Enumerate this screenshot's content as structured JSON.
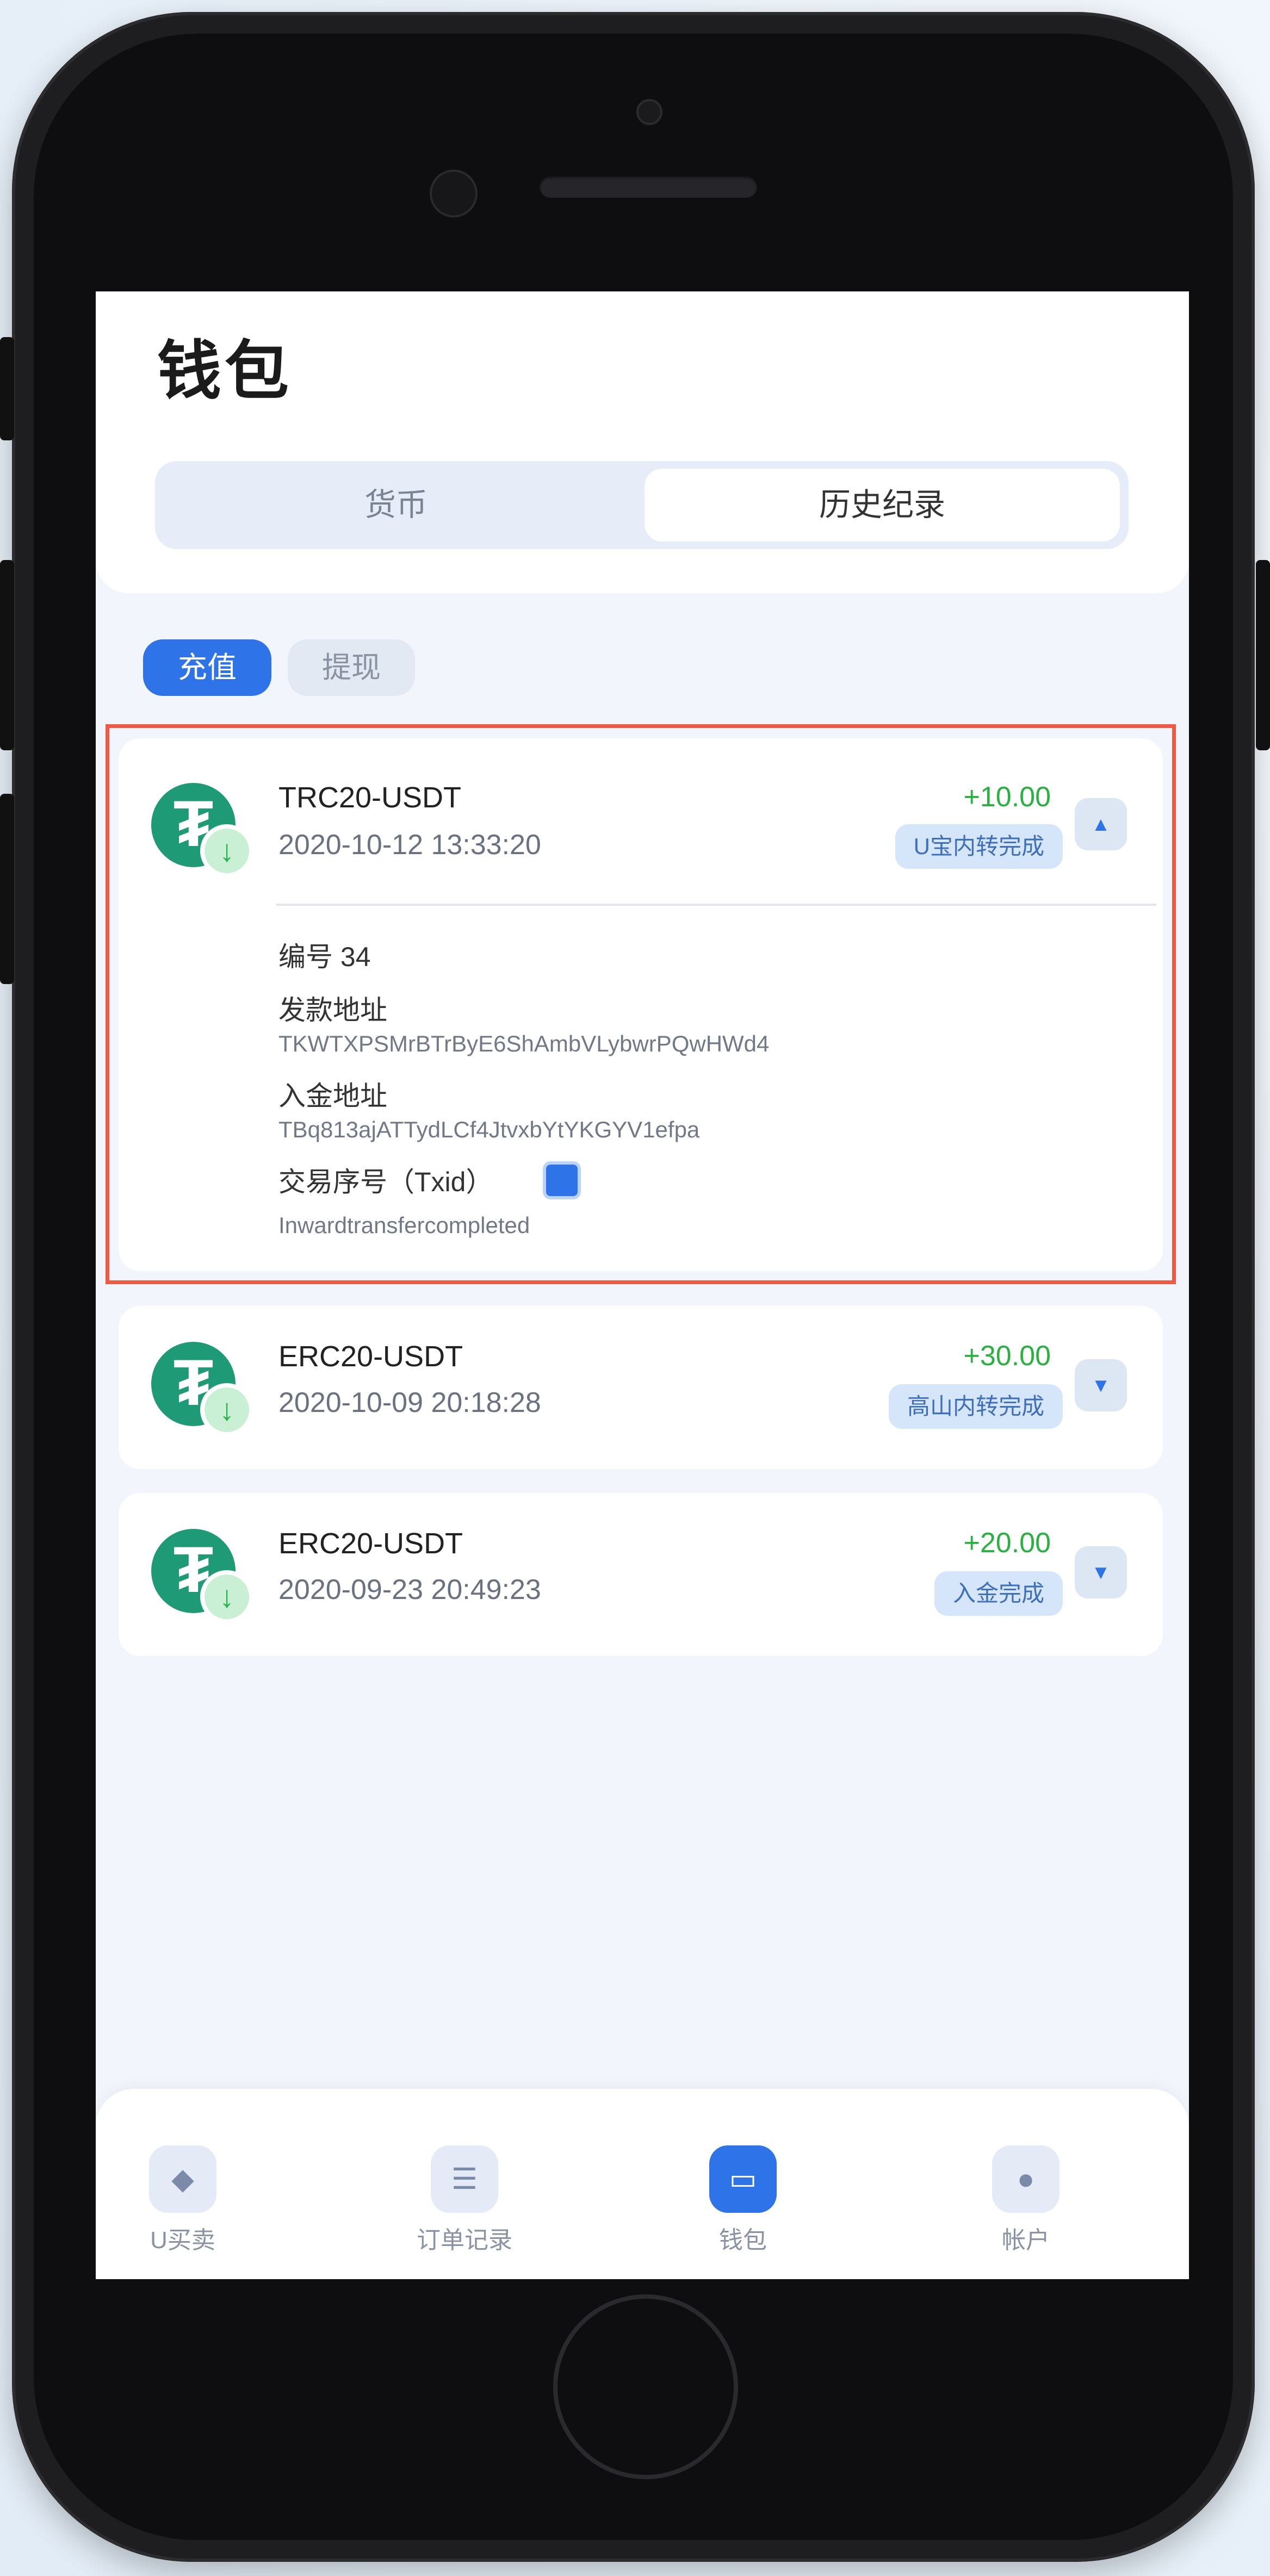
{
  "header": {
    "title": "钱包"
  },
  "segments": [
    {
      "label": "货币",
      "active": false
    },
    {
      "label": "历史纪录",
      "active": true
    }
  ],
  "filters": [
    {
      "label": "充值",
      "active": true
    },
    {
      "label": "提现",
      "active": false
    }
  ],
  "records": [
    {
      "coin_icon": "tether-icon",
      "name": "TRC20-USDT",
      "time": "2020-10-12 13:33:20",
      "amount": "+10.00",
      "status": "U宝内转完成",
      "expanded": true,
      "details": {
        "number_label": "编号 34",
        "sender_label": "发款地址",
        "sender_value": "TKWTXPSMrBTrByE6ShAmbVLybwrPQwHWd4",
        "receiver_label": "入金地址",
        "receiver_value": "TBq813ajATTydLCf4JtvxbYtYKGYV1efpa",
        "txid_label": "交易序号（Txid）",
        "txid_value": "Inwardtransfercompleted"
      }
    },
    {
      "coin_icon": "tether-icon",
      "name": "ERC20-USDT",
      "time": "2020-10-09 20:18:28",
      "amount": "+30.00",
      "status": "高山内转完成",
      "expanded": false
    },
    {
      "coin_icon": "tether-icon",
      "name": "ERC20-USDT",
      "time": "2020-09-23 20:49:23",
      "amount": "+20.00",
      "status": "入金完成",
      "expanded": false
    }
  ],
  "tabbar": [
    {
      "label": "U买卖",
      "icon": "diamond-icon",
      "active": false
    },
    {
      "label": "订单记录",
      "icon": "list-icon",
      "active": false
    },
    {
      "label": "钱包",
      "icon": "wallet-icon",
      "active": true
    },
    {
      "label": "帐户",
      "icon": "user-icon",
      "active": false
    }
  ],
  "colors": {
    "accent": "#2f73e8",
    "positive": "#2bb042",
    "coin": "#1f9a76",
    "highlight_border": "#ee5a43"
  }
}
